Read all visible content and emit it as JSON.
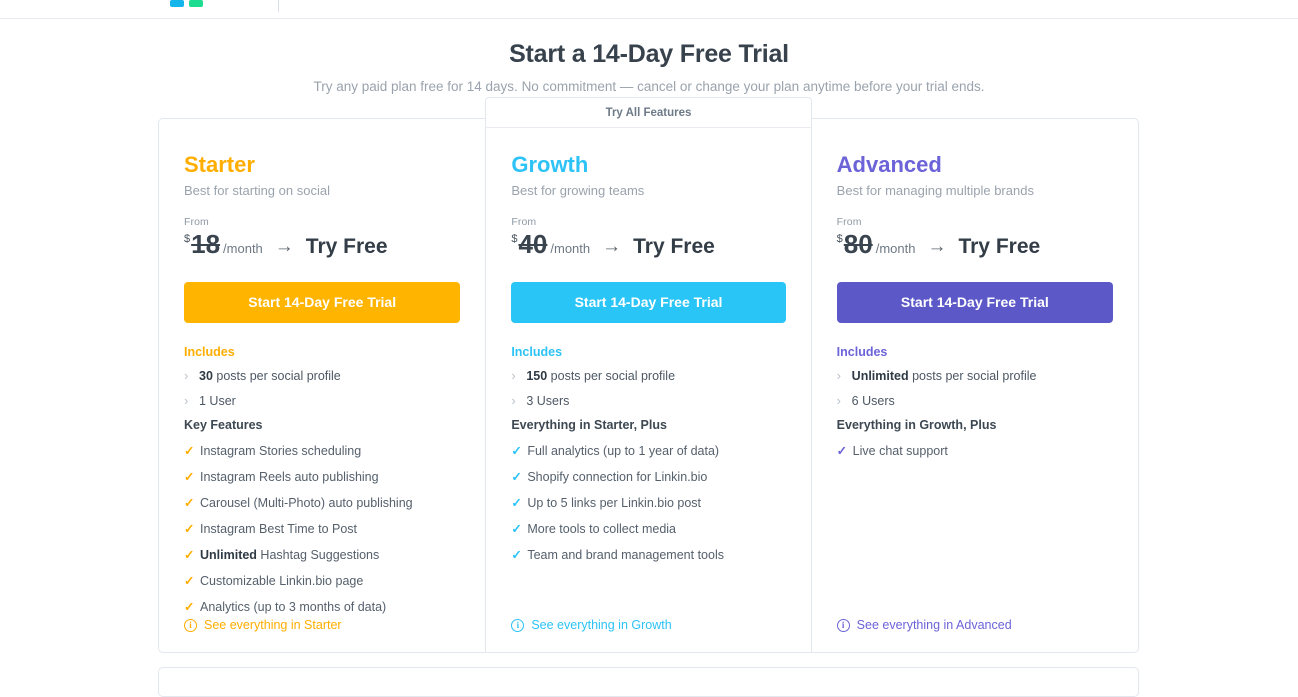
{
  "header": {
    "logo_icon": "later-logo-fragment"
  },
  "page": {
    "title": "Start a 14-Day Free Trial",
    "subtitle": "Try any paid plan free for 14 days. No commitment — cancel or change your plan anytime before your trial ends."
  },
  "labels": {
    "from": "From",
    "currency": "$",
    "per_month": "/month",
    "arrow": "→",
    "try_free": "Try Free",
    "includes": "Includes",
    "ribbon": "Try All Features",
    "chevron_icon": "›",
    "check_icon": "✓",
    "info_icon": "i"
  },
  "plans": [
    {
      "name": "Starter",
      "description": "Best for starting on social",
      "price": "18",
      "color": "#ffae00",
      "button_color": "#ffb400",
      "cta": "Start 14-Day Free Trial",
      "highlighted": false,
      "includes": [
        {
          "strong": "30",
          "rest": " posts per social profile"
        },
        {
          "strong": "",
          "rest": "1 User"
        }
      ],
      "features_heading": "Key Features",
      "features": [
        {
          "strong": "",
          "rest": "Instagram Stories scheduling"
        },
        {
          "strong": "",
          "rest": "Instagram Reels auto publishing"
        },
        {
          "strong": "",
          "rest": "Carousel (Multi-Photo) auto publishing"
        },
        {
          "strong": "",
          "rest": "Instagram Best Time to Post"
        },
        {
          "strong": "Unlimited",
          "rest": " Hashtag Suggestions"
        },
        {
          "strong": "",
          "rest": "Customizable Linkin.bio page"
        },
        {
          "strong": "",
          "rest": "Analytics (up to 3 months of data)"
        }
      ],
      "see_more": "See everything in Starter"
    },
    {
      "name": "Growth",
      "description": "Best for growing teams",
      "price": "40",
      "color": "#2dc3f7",
      "button_color": "#29c5f6",
      "cta": "Start 14-Day Free Trial",
      "highlighted": true,
      "ribbon": "Try All Features",
      "includes": [
        {
          "strong": "150",
          "rest": " posts per social profile"
        },
        {
          "strong": "",
          "rest": "3 Users"
        }
      ],
      "features_heading": "Everything in Starter, Plus",
      "features": [
        {
          "strong": "",
          "rest": "Full analytics (up to 1 year of data)"
        },
        {
          "strong": "",
          "rest": "Shopify connection for Linkin.bio"
        },
        {
          "strong": "",
          "rest": "Up to 5 links per Linkin.bio post"
        },
        {
          "strong": "",
          "rest": "More tools to collect media"
        },
        {
          "strong": "",
          "rest": "Team and brand management tools"
        }
      ],
      "see_more": "See everything in Growth"
    },
    {
      "name": "Advanced",
      "description": "Best for managing multiple brands",
      "price": "80",
      "color": "#6c63d8",
      "button_color": "#5c58c8",
      "cta": "Start 14-Day Free Trial",
      "highlighted": false,
      "includes": [
        {
          "strong": "Unlimited",
          "rest": " posts per social profile"
        },
        {
          "strong": "",
          "rest": "6 Users"
        }
      ],
      "features_heading": "Everything in Growth, Plus",
      "features": [
        {
          "strong": "",
          "rest": "Live chat support"
        }
      ],
      "see_more": "See everything in Advanced"
    }
  ]
}
